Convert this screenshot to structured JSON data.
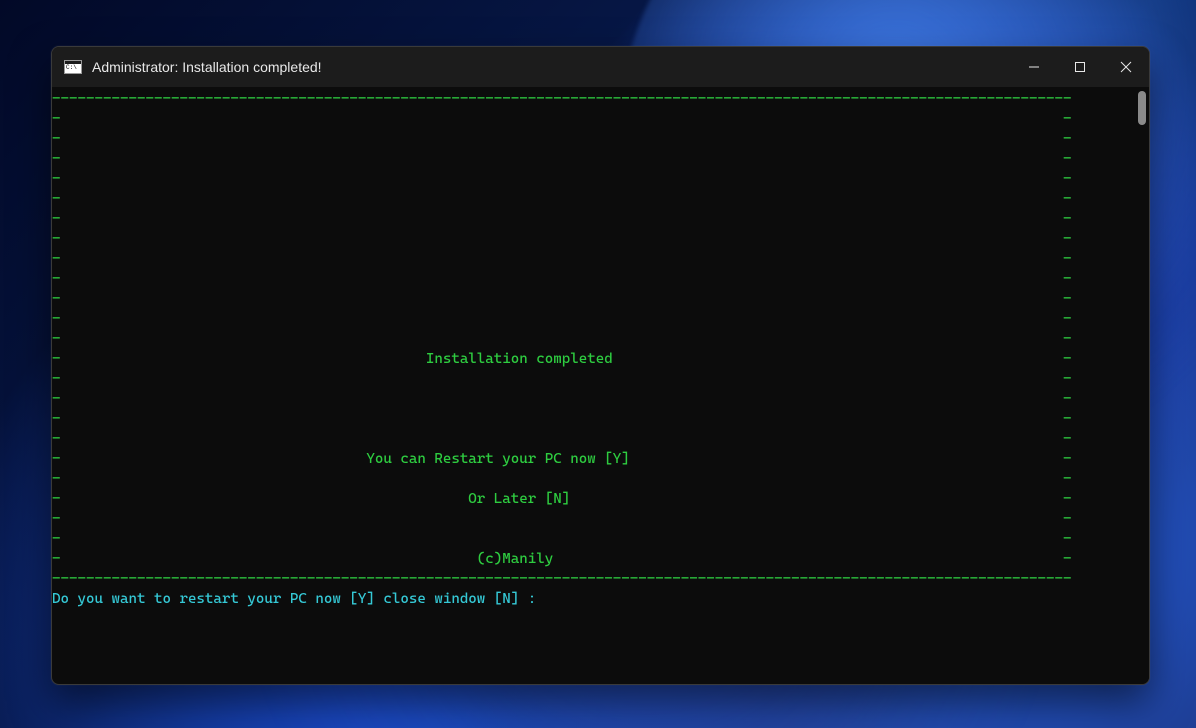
{
  "titlebar": {
    "title": "Administrator:  Installation completed!"
  },
  "console": {
    "border_top": "------------------------------------------------------------------------------------------------------------------------",
    "border_side": "-                                                                                                                      -",
    "line_status": "-                                           Installation completed                                                     -",
    "line_restart": "-                                    You can Restart your PC now [Y]                                                   -",
    "line_later": "-                                                Or Later [N]                                                          -",
    "line_credit": "-                                                 (c)Manily                                                            -",
    "border_bottom": "------------------------------------------------------------------------------------------------------------------------",
    "prompt": "Do you want to restart your PC now [Y] close window [N] :"
  }
}
